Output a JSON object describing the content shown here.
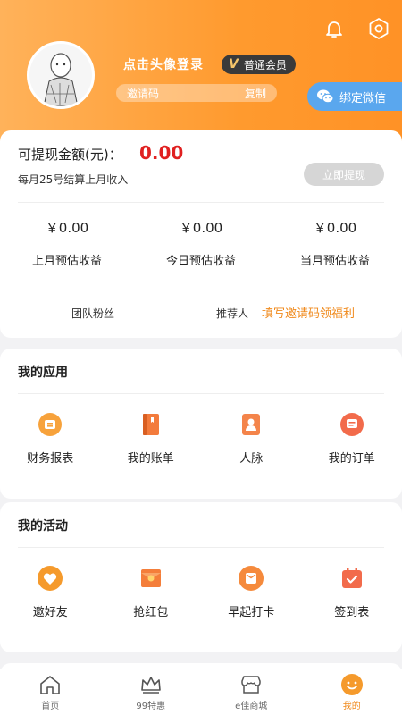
{
  "header": {
    "login_text": "点击头像登录",
    "member_badge": {
      "letter": "V",
      "label": "普通会员"
    },
    "invite_code_label": "邀请码",
    "copy_label": "复制",
    "wechat_bind_label": "绑定微信",
    "icons": [
      "bell-icon",
      "settings-icon"
    ]
  },
  "wallet": {
    "title": "可提现金额(元)：",
    "amount": "0.00",
    "settle_note": "每月25号结算上月收入",
    "withdraw_label": "立即提现",
    "stats": [
      {
        "value": "￥0.00",
        "label": "上月预估收益"
      },
      {
        "value": "￥0.00",
        "label": "今日预估收益"
      },
      {
        "value": "￥0.00",
        "label": "当月预估收益"
      }
    ],
    "team_label": "团队粉丝",
    "referrer_label": "推荐人",
    "fill_invite_label": "填写邀请码领福利"
  },
  "apps": {
    "title": "我的应用",
    "items": [
      {
        "label": "财务报表",
        "icon": "finance-report-icon"
      },
      {
        "label": "我的账单",
        "icon": "bill-book-icon"
      },
      {
        "label": "人脉",
        "icon": "contacts-icon"
      },
      {
        "label": "我的订单",
        "icon": "order-icon"
      }
    ]
  },
  "activities": {
    "title": "我的活动",
    "items": [
      {
        "label": "邀好友",
        "icon": "heart-icon"
      },
      {
        "label": "抢红包",
        "icon": "red-envelope-icon"
      },
      {
        "label": "早起打卡",
        "icon": "alarm-icon"
      },
      {
        "label": "签到表",
        "icon": "checkin-calendar-icon"
      }
    ]
  },
  "tabbar": {
    "items": [
      {
        "label": "首页",
        "icon": "home-icon"
      },
      {
        "label": "99特惠",
        "icon": "crown-icon"
      },
      {
        "label": "e佳商城",
        "icon": "store-icon"
      },
      {
        "label": "我的",
        "icon": "smiley-icon",
        "active": true
      }
    ]
  },
  "colors": {
    "header_gradient_start": "#ffb25a",
    "header_gradient_end": "#ff9226",
    "accent": "#f08a1c",
    "amount_red": "#e02020",
    "wechat_blue": "#5aa7ee"
  }
}
